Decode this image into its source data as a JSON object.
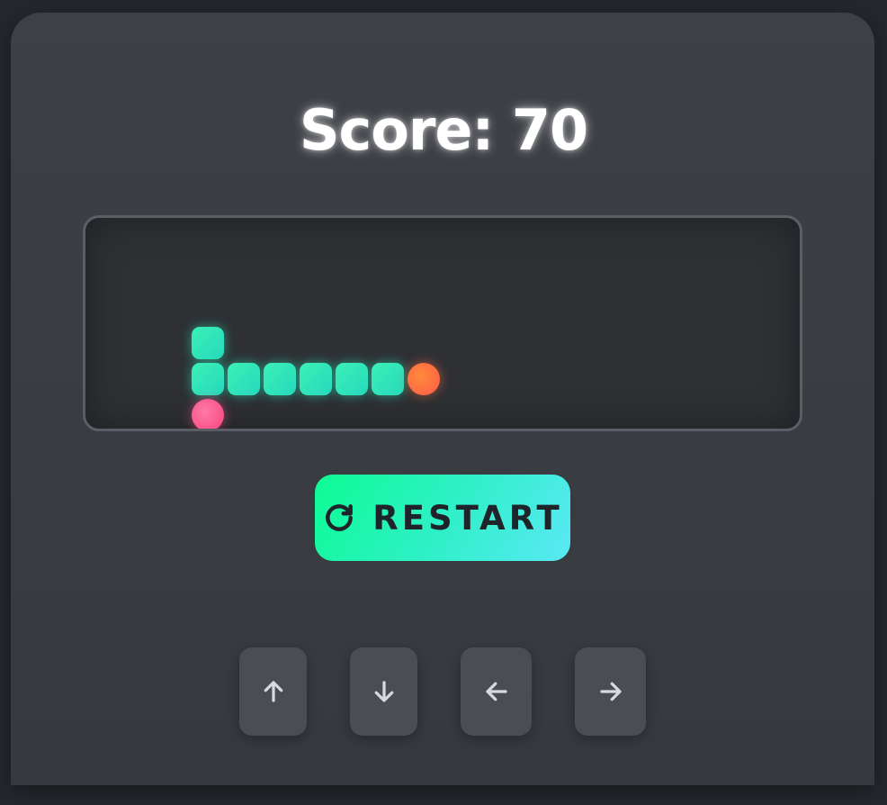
{
  "score": {
    "text": "Score: 70",
    "value": 70
  },
  "board": {
    "snake_body": [
      {
        "col": 1,
        "row": 1
      },
      {
        "col": 1,
        "row": 2
      },
      {
        "col": 2,
        "row": 2
      },
      {
        "col": 3,
        "row": 2
      },
      {
        "col": 4,
        "row": 2
      },
      {
        "col": 5,
        "row": 2
      },
      {
        "col": 6,
        "row": 2
      }
    ],
    "snake_head": {
      "col": 7,
      "row": 2
    },
    "food": {
      "col": 1,
      "row": 3
    },
    "colors": {
      "snake": "#2ee8bc",
      "head": "#ff6a45",
      "food": "#f7427e"
    }
  },
  "controls": {
    "restart_label": "RESTART",
    "restart_icon": "refresh-icon",
    "directions": [
      {
        "name": "up",
        "icon": "arrow-up-icon"
      },
      {
        "name": "down",
        "icon": "arrow-down-icon"
      },
      {
        "name": "left",
        "icon": "arrow-left-icon"
      },
      {
        "name": "right",
        "icon": "arrow-right-icon"
      }
    ]
  },
  "colors": {
    "background": "#24272c",
    "card": "#3b3e44",
    "accent_start": "#0dfc93",
    "accent_end": "#5ae8f5"
  }
}
